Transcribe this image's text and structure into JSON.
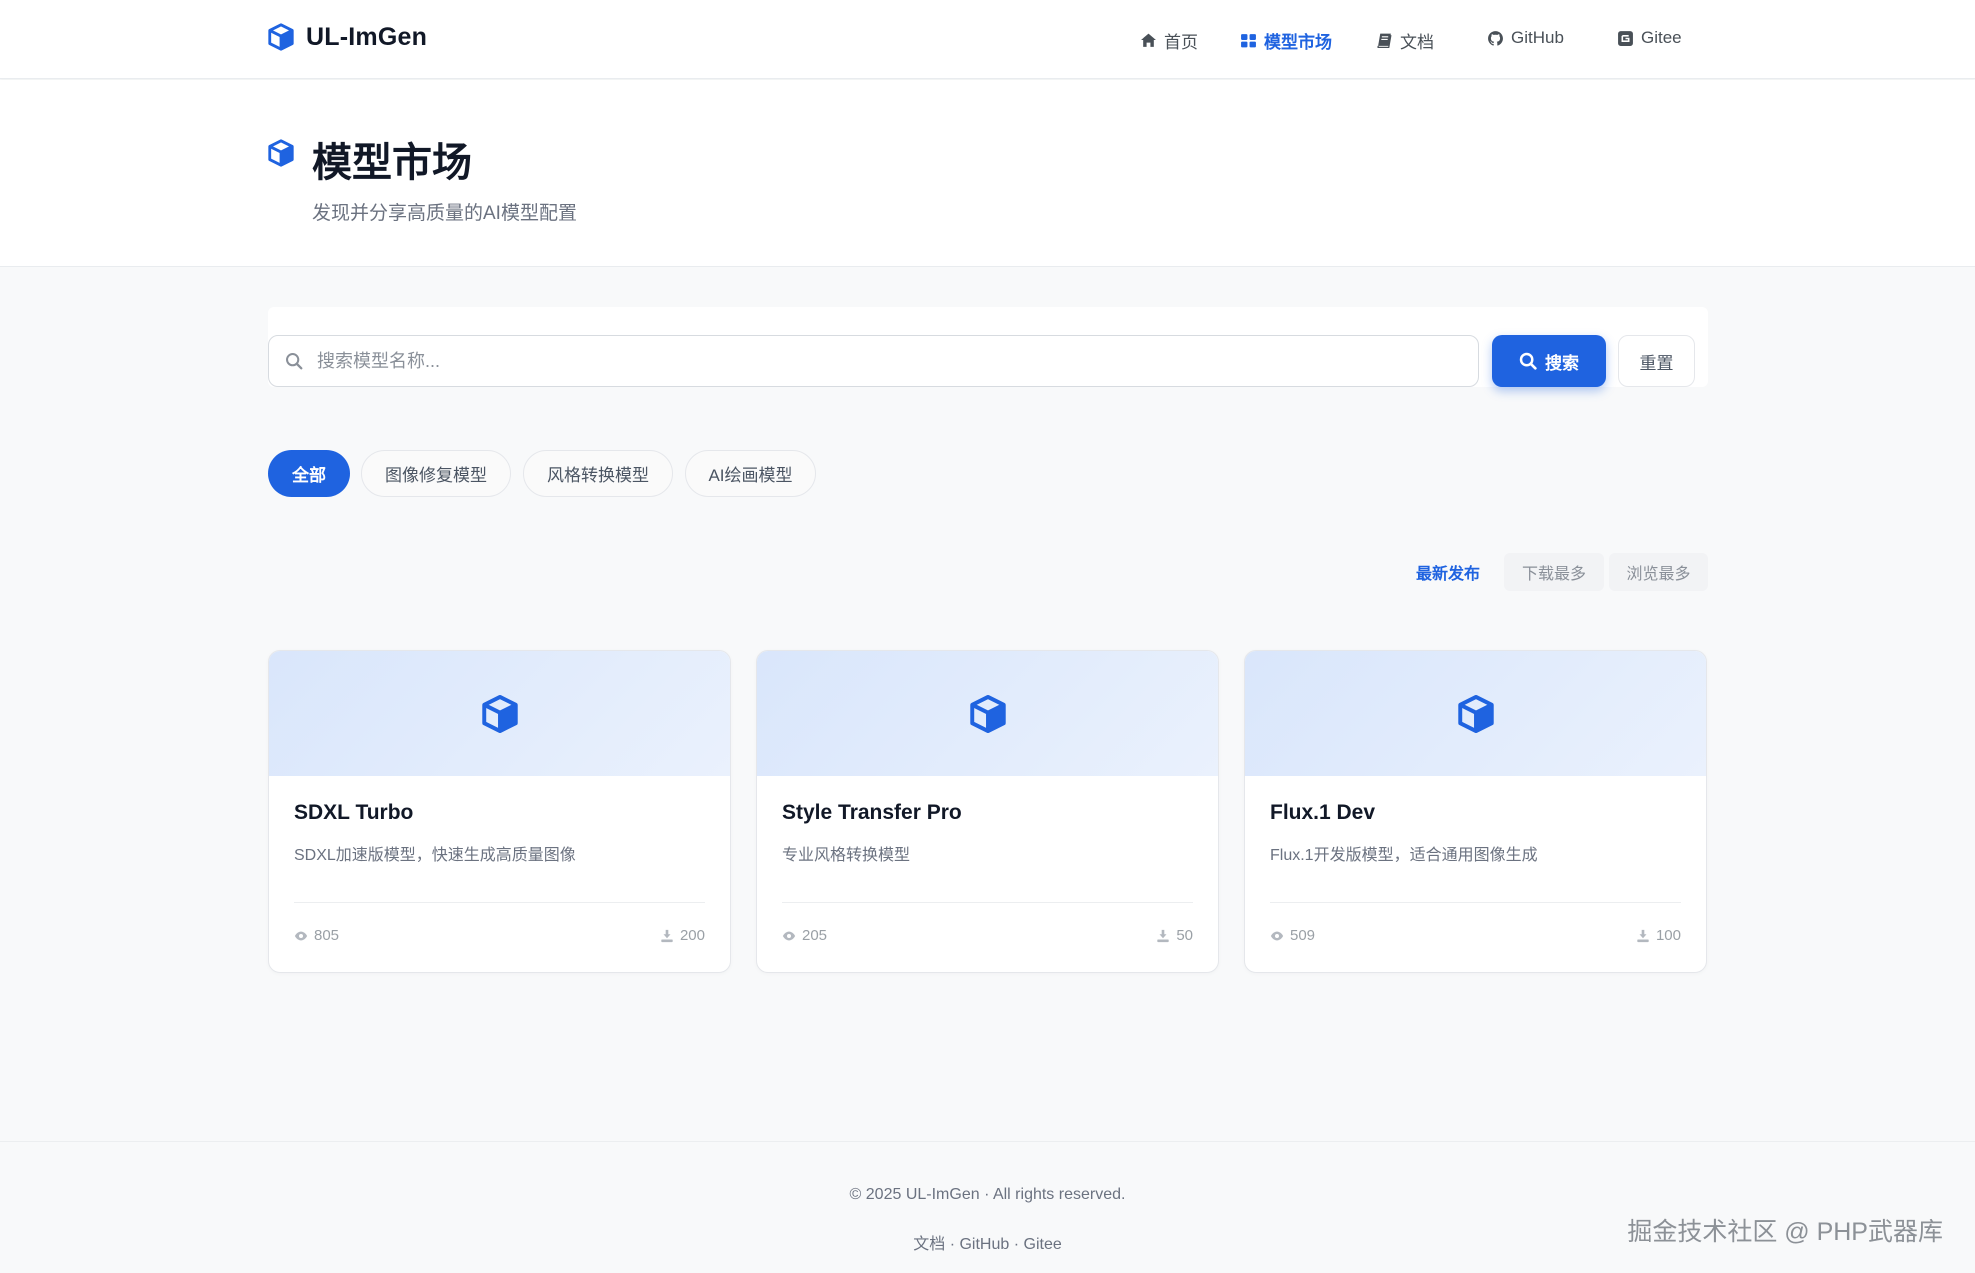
{
  "header": {
    "brand": "UL-ImGen",
    "nav": [
      {
        "label": "首页",
        "icon": "home-icon"
      },
      {
        "label": "模型市场",
        "icon": "grid-icon",
        "active": true
      },
      {
        "label": "文档",
        "icon": "book-icon"
      },
      {
        "label": "GitHub",
        "icon": "github-icon"
      },
      {
        "label": "Gitee",
        "icon": "gitee-icon"
      }
    ]
  },
  "hero": {
    "title": "模型市场",
    "subtitle": "发现并分享高质量的AI模型配置"
  },
  "search": {
    "placeholder": "搜索模型名称...",
    "value": "",
    "search_label": "搜索",
    "reset_label": "重置"
  },
  "categories": [
    {
      "label": "全部",
      "active": true
    },
    {
      "label": "图像修复模型"
    },
    {
      "label": "风格转换模型"
    },
    {
      "label": "AI绘画模型"
    }
  ],
  "sort": [
    {
      "label": "最新发布",
      "active": true
    },
    {
      "label": "下载最多"
    },
    {
      "label": "浏览最多"
    }
  ],
  "models": [
    {
      "name": "SDXL Turbo",
      "description": "SDXL加速版模型，快速生成高质量图像",
      "views": "805",
      "downloads": "200"
    },
    {
      "name": "Style Transfer Pro",
      "description": "专业风格转换模型",
      "views": "205",
      "downloads": "50"
    },
    {
      "name": "Flux.1 Dev",
      "description": "Flux.1开发版模型，适合通用图像生成",
      "views": "509",
      "downloads": "100"
    }
  ],
  "footer": {
    "copyright": "© 2025 UL-ImGen · All rights reserved.",
    "links": [
      "文档",
      "GitHub",
      "Gitee"
    ],
    "separator": " · "
  },
  "watermark": "掘金技术社区 @ PHP武器库",
  "colors": {
    "accent": "#1f63e0",
    "background": "#f8f9fa",
    "card_thumb": "#e2ecfc"
  }
}
